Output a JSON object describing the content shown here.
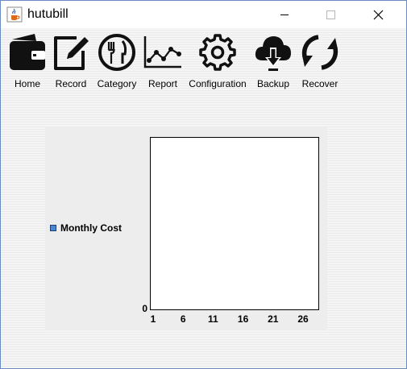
{
  "window": {
    "title": "hutubill",
    "icon": "java-cup-icon",
    "controls": [
      "minimize-icon",
      "maximize-icon",
      "close-icon"
    ]
  },
  "toolbar": {
    "items": [
      {
        "label": "Home",
        "icon": "wallet-icon"
      },
      {
        "label": "Record",
        "icon": "pencil-edit-icon"
      },
      {
        "label": "Category",
        "icon": "fork-knife-plate-icon"
      },
      {
        "label": "Report",
        "icon": "line-chart-icon"
      },
      {
        "label": "Configuration",
        "icon": "gear-icon"
      },
      {
        "label": "Backup",
        "icon": "cloud-download-icon"
      },
      {
        "label": "Recover",
        "icon": "refresh-icon"
      }
    ]
  },
  "chart_data": {
    "type": "bar",
    "title": "",
    "xlabel": "",
    "ylabel": "",
    "legend_position": "left",
    "grid": false,
    "series": [
      {
        "name": "Monthly Cost",
        "color": "#4a86d6",
        "values": []
      }
    ],
    "x_ticks": [
      "1",
      "6",
      "11",
      "16",
      "21",
      "26"
    ],
    "y_ticks": [
      "0"
    ],
    "ylim": [
      0,
      0
    ]
  }
}
